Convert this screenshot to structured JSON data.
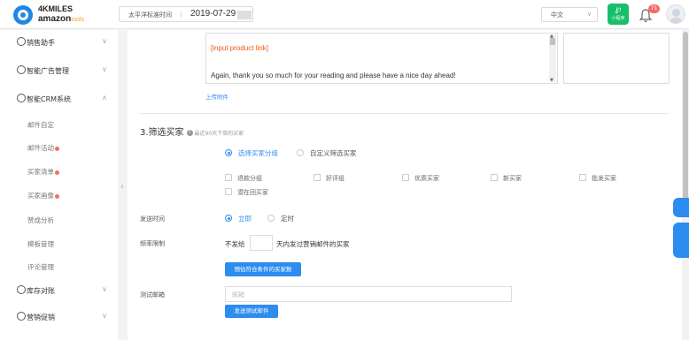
{
  "header": {
    "logo_line1": "4KMILES",
    "logo_line2": "amazon",
    "logo_line3": "tools",
    "timezone_label": "太平洋标准时间",
    "date_value": "2019-07-29",
    "language": "中文",
    "mini_program_label": "小程序",
    "notification_count": "71"
  },
  "sidebar": {
    "groups": [
      {
        "label": "销售助手"
      },
      {
        "label": "智能广告管理"
      },
      {
        "label": "智能CRM系统"
      },
      {
        "label": "库存对账"
      },
      {
        "label": "营销促销"
      }
    ],
    "crm_items": [
      {
        "label": "邮件自定"
      },
      {
        "label": "邮件活动"
      },
      {
        "label": "买家清单"
      },
      {
        "label": "买家画像"
      },
      {
        "label": "赞成分析"
      },
      {
        "label": "模板管理"
      },
      {
        "label": "评论管理"
      }
    ]
  },
  "editor": {
    "line1": "[input product link]",
    "line2": "Again, thank you so much for your reading and please have a nice day ahead!",
    "upload_link": "上传附件"
  },
  "filter": {
    "section_title": "3.筛选买家",
    "hint": "最近90天下单的买家",
    "mode_options": [
      "选择买家分组",
      "自定义筛选买家"
    ],
    "groups": [
      "退款分组",
      "好评组",
      "优质买家",
      "新买家",
      "批发买家",
      "潜在回买家"
    ]
  },
  "send": {
    "time_label": "发送时间",
    "time_options": [
      "立即",
      "定时"
    ],
    "freq_label": "频率限制",
    "freq_prefix": "不发给",
    "freq_suffix": "天内发过营销邮件的买家",
    "preview_button": "预估符合条件的买家数",
    "test_email_label": "测试邮箱",
    "test_email_placeholder": "邮箱",
    "send_test_button": "发送测试邮件"
  },
  "colors": {
    "accent": "#2d8cf0",
    "danger": "#f56c6c",
    "green": "#19be6b"
  }
}
